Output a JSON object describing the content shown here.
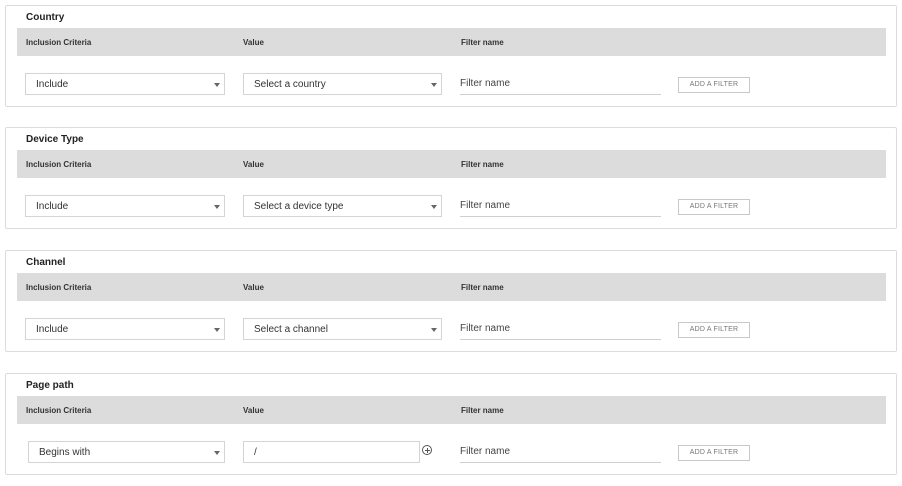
{
  "columns": {
    "criteria": "Inclusion Criteria",
    "value": "Value",
    "filter": "Filter name"
  },
  "panels": [
    {
      "title": "Country",
      "criteria": "Include",
      "value": "Select a country",
      "filter_placeholder": "Filter name",
      "button": "ADD A FILTER"
    },
    {
      "title": "Device Type",
      "criteria": "Include",
      "value": "Select a device type",
      "filter_placeholder": "Filter name",
      "button": "ADD A FILTER"
    },
    {
      "title": "Channel",
      "criteria": "Include",
      "value": "Select a channel",
      "filter_placeholder": "Filter name",
      "button": "ADD A FILTER"
    },
    {
      "title": "Page path",
      "criteria": "Begins with",
      "value": "/",
      "filter_placeholder": "Filter name",
      "button": "ADD A FILTER"
    }
  ],
  "icons": {
    "dropdown": "chevron-down-icon",
    "add_path": "plus-circle-icon"
  }
}
